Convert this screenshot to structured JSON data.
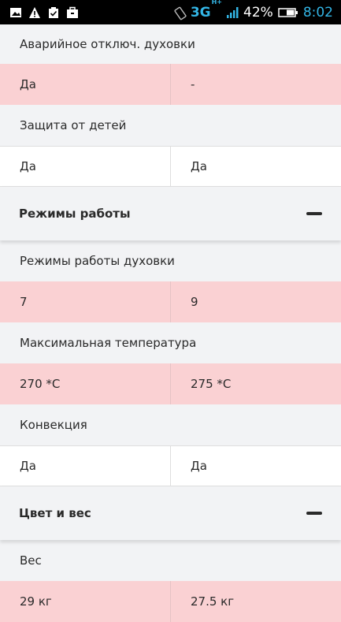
{
  "status_bar": {
    "network": "3G",
    "network_sup": "H+",
    "battery_percent": "42%",
    "time": "8:02",
    "icons": [
      "image-icon",
      "warning-icon",
      "clipboard-check-icon",
      "work-icon",
      "rotation-icon",
      "signal-icon",
      "battery-icon"
    ]
  },
  "rows": {
    "emergency_off": {
      "label": "Аварийное отключ. духовки",
      "left": "Да",
      "right": "-"
    },
    "child_lock": {
      "label": "Защита от детей",
      "left": "Да",
      "right": "Да"
    }
  },
  "sections": {
    "modes": {
      "title": "Режимы работы",
      "items": {
        "oven_modes": {
          "label": "Режимы работы духовки",
          "left": "7",
          "right": "9"
        },
        "max_temp": {
          "label": "Максимальная температура",
          "left": "270 *C",
          "right": "275 *C"
        },
        "convection": {
          "label": "Конвекция",
          "left": "Да",
          "right": "Да"
        }
      }
    },
    "color_weight": {
      "title": "Цвет и вес",
      "items": {
        "weight": {
          "label": "Вес",
          "left": "29 кг",
          "right": "27.5 кг"
        }
      }
    }
  },
  "colors": {
    "highlight": "#fad1d3",
    "label_bg": "#f2f3f5",
    "status_accent": "#33b5e5"
  }
}
